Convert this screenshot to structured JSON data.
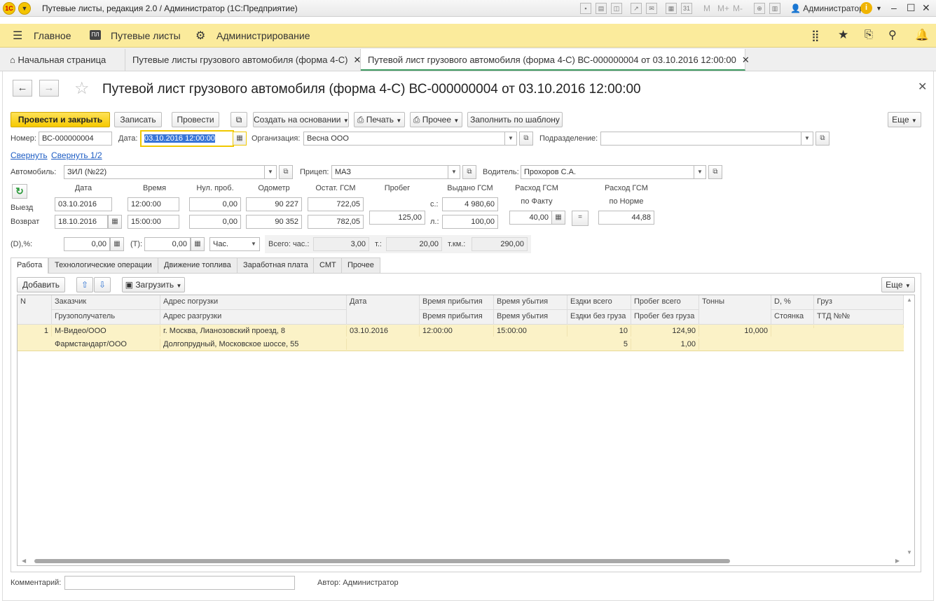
{
  "window": {
    "title": "Путевые листы, редакция 2.0 / Администратор  (1С:Предприятие)",
    "user": "Администратор",
    "toolbar_labels": [
      "M",
      "M+",
      "M-"
    ]
  },
  "menu": {
    "items": [
      {
        "label": "Главное",
        "icon": "hamburger-icon"
      },
      {
        "label": "Путевые листы",
        "icon": "pl-icon"
      },
      {
        "label": "Администрирование",
        "icon": "gear-icon"
      }
    ]
  },
  "tabs": [
    {
      "label": "Начальная страница"
    },
    {
      "label": "Путевые листы грузового автомобиля (форма 4-С)"
    },
    {
      "label": "Путевой лист грузового автомобиля (форма 4-С) ВС-000000004 от 03.10.2016 12:00:00"
    }
  ],
  "form": {
    "title": "Путевой лист грузового автомобиля (форма 4-С) ВС-000000004 от 03.10.2016 12:00:00",
    "buttons": {
      "post_close": "Провести и закрыть",
      "save": "Записать",
      "post": "Провести",
      "create_based": "Создать на основании",
      "print": "Печать",
      "other": "Прочее",
      "fill_template": "Заполнить по шаблону",
      "more": "Еще"
    },
    "number_label": "Номер:",
    "number": "ВС-000000004",
    "date_label": "Дата:",
    "date": "03.10.2016 12:00:00",
    "org_label": "Организация:",
    "org": "Весна ООО",
    "dept_label": "Подразделение:",
    "dept": "",
    "collapse": "Свернуть",
    "collapse_half": "Свернуть 1/2",
    "car_label": "Автомобиль:",
    "car": "ЗИЛ (№22)",
    "trailer_label": "Прицеп:",
    "trailer": "МАЗ",
    "driver_label": "Водитель:",
    "driver": "Прохоров С.А.",
    "cols": {
      "date": "Дата",
      "time": "Время",
      "zero": "Нул. проб.",
      "odometer": "Одометр",
      "fuel_left": "Остат. ГСМ",
      "mileage": "Пробег",
      "fuel_issued": "Выдано ГСМ",
      "fuel_fact_1": "Расход ГСМ",
      "fuel_fact_2": "по Факту",
      "fuel_norm_1": "Расход ГСМ",
      "fuel_norm_2": "по Норме"
    },
    "depart": {
      "label": "Выезд",
      "date": "03.10.2016",
      "time": "12:00:00",
      "zero": "0,00",
      "odometer": "90 227",
      "fuel": "722,05"
    },
    "return": {
      "label": "Возврат",
      "date": "18.10.2016",
      "time": "15:00:00",
      "zero": "0,00",
      "odometer": "90 352",
      "fuel": "782,05"
    },
    "mileage": "125,00",
    "issued_s_label": "с.:",
    "issued_s": "4 980,60",
    "issued_l_label": "л.:",
    "issued_l": "100,00",
    "fuel_fact": "40,00",
    "equals": "=",
    "fuel_norm": "44,88",
    "d_label": "(D),%:",
    "d_value": "0,00",
    "t_label": "(T):",
    "t_value": "0,00",
    "unit": "Час.",
    "total_h_label": "Всего: час.:",
    "total_h": "3,00",
    "total_t_label": "т.:",
    "total_t": "20,00",
    "total_tkm_label": "т.км.:",
    "total_tkm": "290,00",
    "comment_label": "Комментарий:",
    "comment": "",
    "author": "Автор: Администратор"
  },
  "pagetabs": [
    "Работа",
    "Технологические операции",
    "Движение топлива",
    "Заработная плата",
    "СМТ",
    "Прочее"
  ],
  "table": {
    "add": "Добавить",
    "load": "Загрузить",
    "more": "Еще",
    "h1": [
      "N",
      "Заказчик",
      "Адрес погрузки",
      "Дата",
      "Время прибытия",
      "Время убытия",
      "Ездки всего",
      "Пробег всего",
      "Тонны",
      "D, %",
      "Груз"
    ],
    "h2": [
      "",
      "Грузополучатель",
      "Адрес разгрузки",
      "",
      "Время прибытия",
      "Время убытия",
      "Ездки без груза",
      "Пробег без груза",
      "",
      "Стоянка",
      "ТТД №№"
    ],
    "r1": [
      "1",
      "М-Видео/ООО",
      "г. Москва, Лианозовский проезд, 8",
      "03.10.2016",
      "12:00:00",
      "15:00:00",
      "10",
      "124,90",
      "10,000",
      "",
      ""
    ],
    "r2": [
      "",
      "Фармстандарт/ООО",
      "Долгопрудный, Московское шоссе, 55",
      "",
      "",
      "",
      "5",
      "1,00",
      "",
      "",
      ""
    ]
  }
}
